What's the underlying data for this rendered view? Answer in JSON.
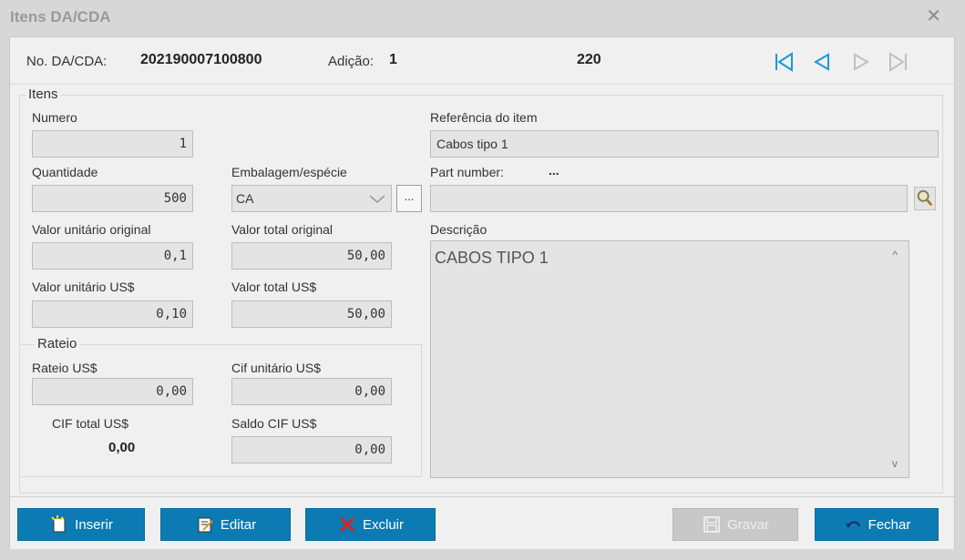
{
  "window": {
    "title": "Itens DA/CDA"
  },
  "header": {
    "no_label": "No. DA/CDA:",
    "no_value": "202190007100800",
    "adicao_label": "Adição:",
    "adicao_value": "1",
    "center_value": "220"
  },
  "itens": {
    "legend": "Itens",
    "numero": {
      "label": "Numero",
      "value": "1"
    },
    "quantidade": {
      "label": "Quantidade",
      "value": "500"
    },
    "embalagem": {
      "label": "Embalagem/espécie",
      "value": "CA",
      "dots": "..."
    },
    "valor_unitario_original": {
      "label": "Valor unitário original",
      "value": "0,1"
    },
    "valor_total_original": {
      "label": "Valor total original",
      "value": "50,00"
    },
    "valor_unitario_usd": {
      "label": "Valor unitário US$",
      "value": "0,10"
    },
    "valor_total_usd": {
      "label": "Valor total US$",
      "value": "50,00"
    },
    "referencia": {
      "label": "Referência do item",
      "value": "Cabos tipo 1"
    },
    "part_number": {
      "label": "Part number:",
      "dots": "...",
      "value": ""
    },
    "descricao": {
      "label": "Descrição",
      "value": "CABOS TIPO 1",
      "scroll_up": "^",
      "scroll_down": "v"
    }
  },
  "rateio": {
    "legend": "Rateio",
    "rateio_usd": {
      "label": "Rateio US$",
      "value": "0,00"
    },
    "cif_unitario": {
      "label": "Cif unitário US$",
      "value": "0,00"
    },
    "cif_total": {
      "label": "CIF total US$",
      "value": "0,00"
    },
    "saldo_cif": {
      "label": "Saldo CIF US$",
      "value": "0,00"
    }
  },
  "buttons": {
    "inserir": "Inserir",
    "editar": "Editar",
    "excluir": "Excluir",
    "gravar": "Gravar",
    "fechar": "Fechar"
  },
  "colors": {
    "accent": "#0c7bb3",
    "nav_active": "#1a9ad6",
    "nav_disabled": "#c0c0c0"
  },
  "icons": {
    "close": "close-icon",
    "first": "first-record-icon",
    "prev": "previous-record-icon",
    "next": "next-record-icon",
    "last": "last-record-icon",
    "search": "magnifier-icon",
    "insert": "new-document-icon",
    "edit": "edit-document-icon",
    "delete": "red-x-icon",
    "save": "floppy-disk-icon",
    "close_btn": "undo-arrow-icon"
  }
}
